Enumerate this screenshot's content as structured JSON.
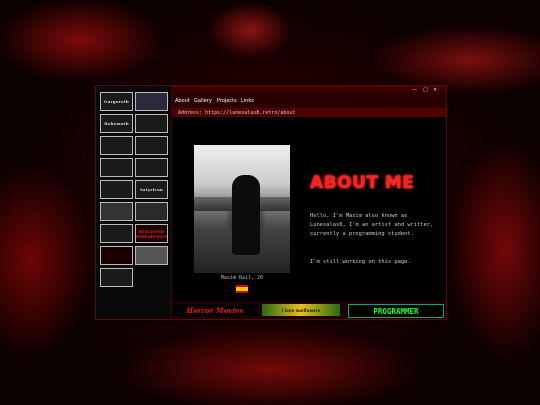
{
  "window": {
    "controls": [
      "—",
      "□",
      "✕"
    ]
  },
  "menu": {
    "items": [
      "About",
      "Gallery",
      "Projects",
      "Links"
    ]
  },
  "address": {
    "label": "Address:",
    "url": "https://lunesalas8.retro/about"
  },
  "sidebar": {
    "badges": [
      {
        "text": "Gorgoroth",
        "style": "dark"
      },
      {
        "text": "",
        "style": "dark"
      },
      {
        "text": "Behemoth",
        "style": "dark"
      },
      {
        "text": "",
        "style": "dark"
      },
      {
        "text": "",
        "style": "dark"
      },
      {
        "text": "",
        "style": "dark"
      },
      {
        "text": "",
        "style": "dark"
      },
      {
        "text": "",
        "style": "dark"
      },
      {
        "text": "",
        "style": "dark"
      },
      {
        "text": "Satyricon",
        "style": "dark"
      },
      {
        "text": "",
        "style": "dark"
      },
      {
        "text": "",
        "style": "dark"
      },
      {
        "text": "",
        "style": "dark"
      },
      {
        "text": "RED DEAD REDEMPTION",
        "style": "red"
      },
      {
        "text": "",
        "style": "red"
      },
      {
        "text": "",
        "style": "dark"
      },
      {
        "text": "",
        "style": "dark"
      }
    ]
  },
  "profile": {
    "caption": "Maxim Rail, 20",
    "title": "ABOUT ME",
    "bio": "Hello, I'm Maxim also known as Lunesalas8, I'm an artist and writter, currently a programming student.",
    "note": "I'm still working on this page."
  },
  "footer": {
    "banners": [
      "Horror Movies",
      "I love sunflowers",
      "PROGRAMMER"
    ]
  }
}
